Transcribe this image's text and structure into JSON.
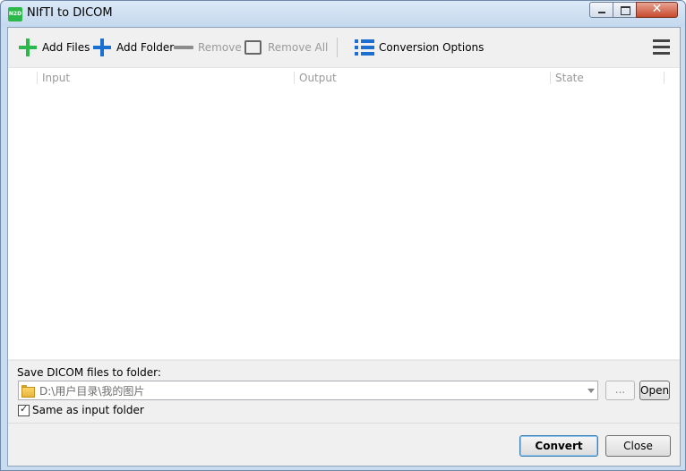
{
  "window": {
    "app_icon_text": "N2D",
    "title": "NIfTI to DICOM",
    "controls": {
      "minimize": "minimize",
      "maximize": "maximize",
      "close": "✕"
    }
  },
  "toolbar": {
    "add_files": {
      "label": "Add Files",
      "icon": "plus-icon",
      "color": "#2db84b"
    },
    "add_folder": {
      "label": "Add Folder",
      "icon": "plus-icon",
      "color": "#1a6fd1"
    },
    "remove": {
      "label": "Remove",
      "icon": "minus-icon",
      "enabled": false
    },
    "remove_all": {
      "label": "Remove All",
      "icon": "box-icon",
      "enabled": false
    },
    "conversion_options": {
      "label": "Conversion Options",
      "icon": "list-icon",
      "color": "#1a6fd1"
    },
    "menu": {
      "icon": "hamburger-menu-icon"
    }
  },
  "table": {
    "columns": [
      "Input",
      "Output",
      "State"
    ],
    "rows": []
  },
  "output": {
    "label": "Save DICOM files to folder:",
    "folder_path": "D:\\用户目录\\我的图片",
    "browse_label": "...",
    "open_label": "Open",
    "same_as_input": {
      "label": "Same as input folder",
      "checked": true
    }
  },
  "footer": {
    "convert_label": "Convert",
    "close_label": "Close"
  }
}
